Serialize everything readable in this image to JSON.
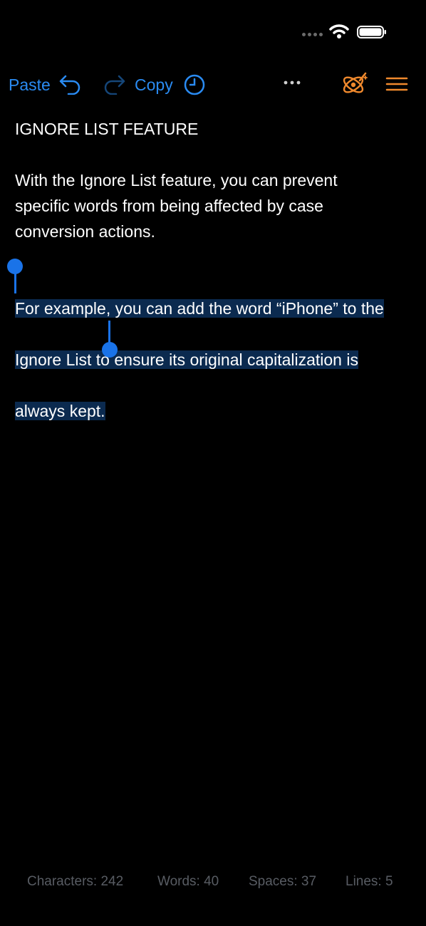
{
  "toolbar": {
    "paste_label": "Paste",
    "copy_label": "Copy",
    "icons": [
      "undo-icon",
      "redo-icon",
      "history-icon",
      "more-icon",
      "magic-icon",
      "menu-icon"
    ],
    "colors": {
      "accent_blue": "#2a8bf2",
      "accent_orange": "#f0892d"
    }
  },
  "editor": {
    "heading": "IGNORE LIST FEATURE",
    "paragraph1": "With the Ignore List feature, you can prevent\nspecific words from being affected by case\nconversion actions.",
    "selected": {
      "line1": "For example, you can add the word “iPhone” to the",
      "line2": "Ignore List to ensure its original capitalization is",
      "line3": "always kept."
    }
  },
  "stats": {
    "characters": "Characters: 242",
    "words": "Words: 40",
    "spaces": "Spaces: 37",
    "lines": "Lines: 5"
  }
}
